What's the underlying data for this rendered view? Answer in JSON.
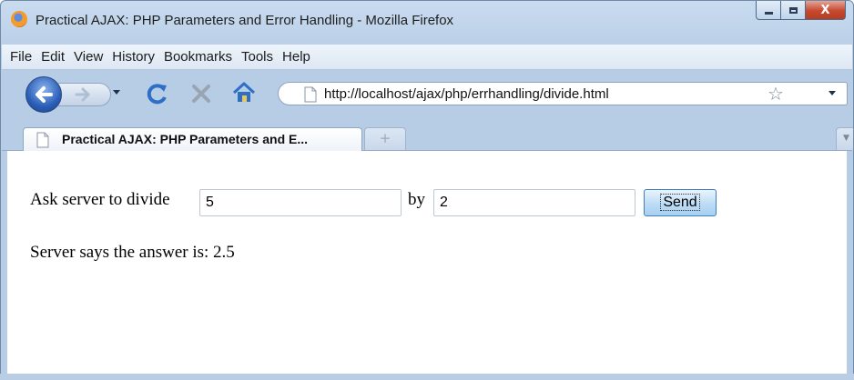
{
  "window": {
    "title": "Practical AJAX: PHP Parameters and Error Handling - Mozilla Firefox",
    "controls": {
      "minimize": "minimize",
      "maximize": "maximize",
      "close": "X"
    }
  },
  "menu": {
    "items": [
      "File",
      "Edit",
      "View",
      "History",
      "Bookmarks",
      "Tools",
      "Help"
    ]
  },
  "navigation": {
    "url": "http://localhost/ajax/php/errhandling/divide.html",
    "icons": [
      "back-icon",
      "forward-icon",
      "reload-icon",
      "stop-icon",
      "home-icon",
      "page-icon",
      "bookmark-star-icon"
    ]
  },
  "tabs": {
    "active_label": "Practical AJAX: PHP Parameters and E...",
    "new_tab_symbol": "+"
  },
  "content": {
    "prompt_text": "Ask server to divide",
    "dividend_value": "5",
    "by_text": "by",
    "divisor_value": "2",
    "send_label": "Send",
    "answer_text": "Server says the answer is: 2.5"
  },
  "colors": {
    "chrome_blue": "#b7cde6",
    "close_red": "#c5482f",
    "send_button_border": "#3d7fc0"
  }
}
